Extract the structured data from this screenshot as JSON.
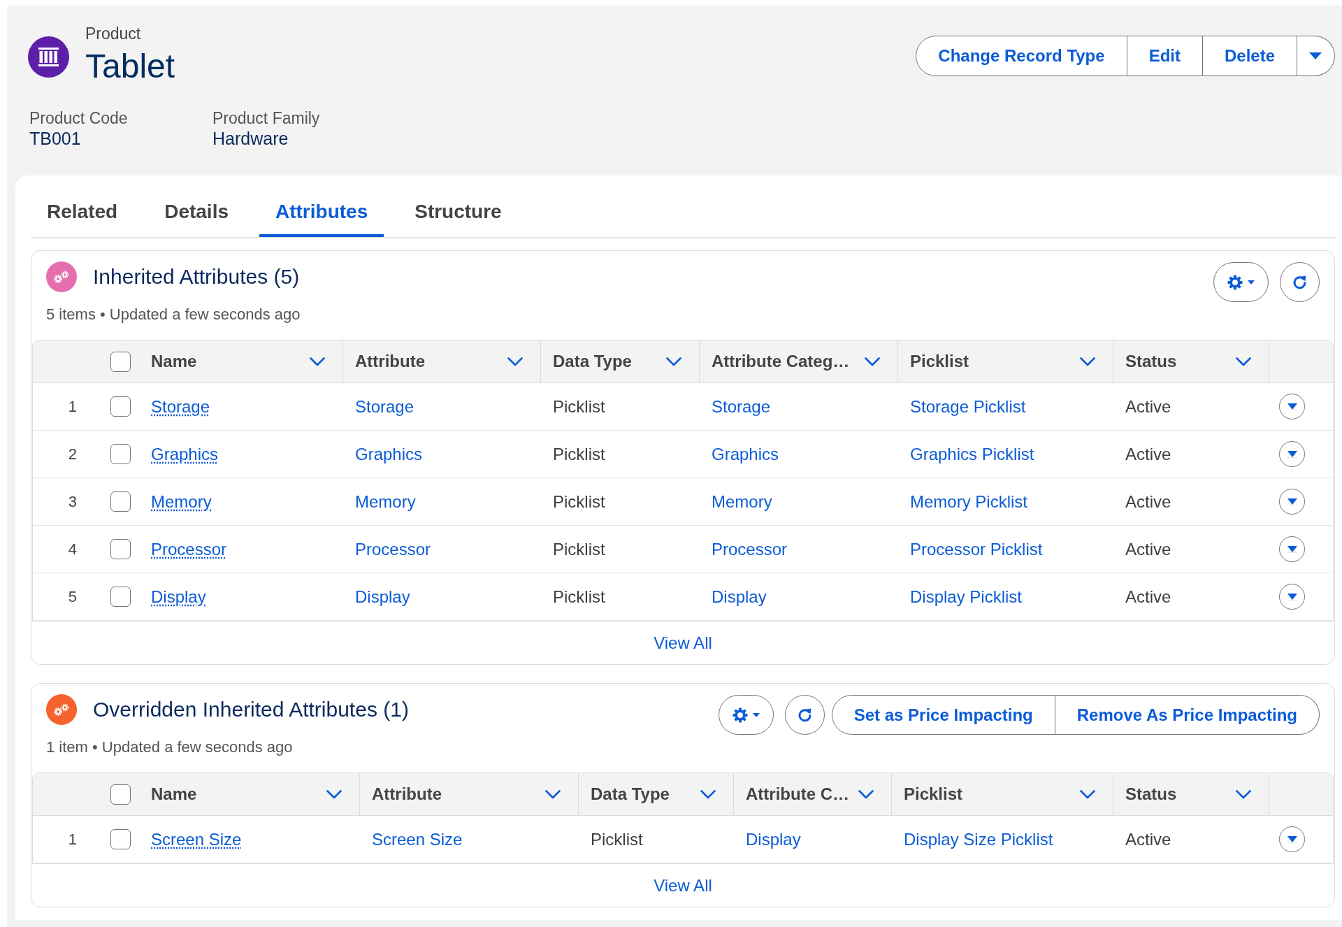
{
  "record": {
    "object_type": "Product",
    "title": "Tablet"
  },
  "header_actions": [
    "Change Record Type",
    "Edit",
    "Delete"
  ],
  "fields": [
    {
      "label": "Product Code",
      "value": "TB001"
    },
    {
      "label": "Product Family",
      "value": "Hardware"
    }
  ],
  "tabs": [
    {
      "label": "Related",
      "selected": false
    },
    {
      "label": "Details",
      "selected": false
    },
    {
      "label": "Attributes",
      "selected": true
    },
    {
      "label": "Structure",
      "selected": false
    }
  ],
  "related_lists": [
    {
      "title": "Inherited Attributes (5)",
      "color": "#e56fae",
      "meta": "5 items • Updated a few seconds ago",
      "table": {
        "all_checked": false,
        "columns": [
          {
            "label": "Name",
            "kind": "primary_link"
          },
          {
            "label": "Attribute",
            "kind": "link"
          },
          {
            "label": "Data Type",
            "kind": "text"
          },
          {
            "label": "Attribute Categ…",
            "kind": "link"
          },
          {
            "label": "Picklist",
            "kind": "link"
          },
          {
            "label": "Status",
            "kind": "text"
          }
        ],
        "rows": [
          {
            "number": "1",
            "checked": false,
            "cells": [
              "Storage",
              "Storage",
              "Picklist",
              "Storage",
              "Storage Picklist",
              "Active"
            ]
          },
          {
            "number": "2",
            "checked": false,
            "cells": [
              "Graphics",
              "Graphics",
              "Picklist",
              "Graphics",
              "Graphics Picklist",
              "Active"
            ]
          },
          {
            "number": "3",
            "checked": false,
            "cells": [
              "Memory",
              "Memory",
              "Picklist",
              "Memory",
              "Memory Picklist",
              "Active"
            ]
          },
          {
            "number": "4",
            "checked": false,
            "cells": [
              "Processor",
              "Processor",
              "Picklist",
              "Processor",
              "Processor Picklist",
              "Active"
            ]
          },
          {
            "number": "5",
            "checked": false,
            "cells": [
              "Display",
              "Display",
              "Picklist",
              "Display",
              "Display Picklist",
              "Active"
            ]
          }
        ]
      },
      "footer_link": "View All"
    },
    {
      "title": "Overridden Inherited Attributes (1)",
      "color": "#f4622e",
      "meta": "1 item • Updated a few seconds ago",
      "actions": [
        "Set as Price Impacting",
        "Remove As Price Impacting"
      ],
      "table": {
        "all_checked": false,
        "columns": [
          {
            "label": "Name",
            "kind": "primary_link"
          },
          {
            "label": "Attribute",
            "kind": "link"
          },
          {
            "label": "Data Type",
            "kind": "text"
          },
          {
            "label": "Attribute C…",
            "kind": "link"
          },
          {
            "label": "Picklist",
            "kind": "link"
          },
          {
            "label": "Status",
            "kind": "text"
          }
        ],
        "rows": [
          {
            "number": "1",
            "checked": false,
            "cells": [
              "Screen Size",
              "Screen Size",
              "Picklist",
              "Display",
              "Display Size Picklist",
              "Active"
            ]
          }
        ]
      },
      "footer_link": "View All"
    }
  ]
}
